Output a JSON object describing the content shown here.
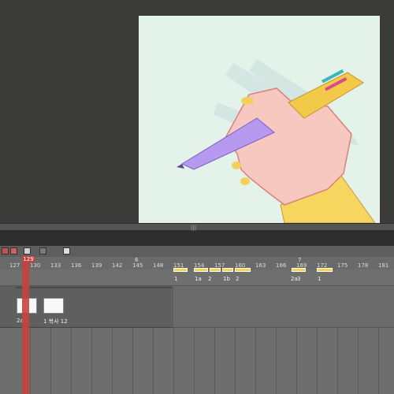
{
  "timeline": {
    "ticks": [
      "127",
      "129",
      "130",
      "133",
      "136",
      "139",
      "142",
      "145",
      "148",
      "151",
      "154",
      "157",
      "160",
      "163",
      "166",
      "169",
      "172",
      "175",
      "178",
      "181"
    ],
    "markers": [
      "6",
      "7"
    ],
    "playhead_frame": "129",
    "track1_labels": [
      "1",
      "1a",
      "2",
      "1b",
      "2",
      "2a",
      "3",
      "1"
    ],
    "track2_labels": [
      "2a",
      "3",
      "1 복사 12"
    ]
  },
  "colors": {
    "playhead": "#c94040",
    "segment": "#f5d64a",
    "artboard": "#e3f3ea"
  }
}
